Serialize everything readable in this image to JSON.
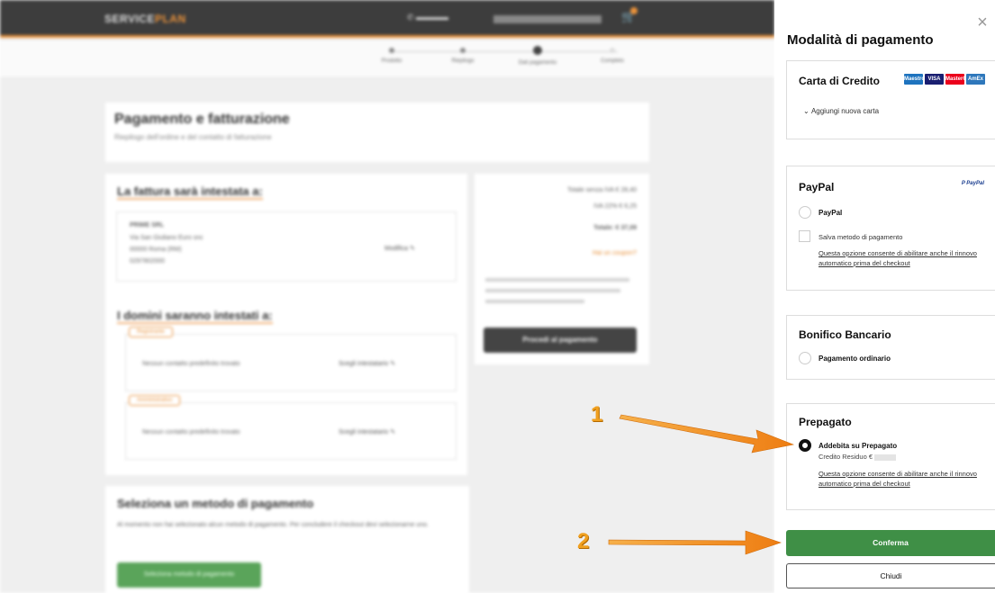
{
  "background": {
    "logo_prefix": "SERVICE",
    "logo_accent": "PLAN",
    "steps": [
      {
        "label": "Prodotto"
      },
      {
        "label": "Riepilogo"
      },
      {
        "label": "Dati pagamento"
      },
      {
        "label": "Completo"
      }
    ],
    "billing_title": "Pagamento e fatturazione",
    "billing_subtitle": "Riepilogo dell'ordine e del contatto di fatturazione",
    "invoice_heading": "La fattura sarà intestata a:",
    "invoice_company": "PRIME SRL",
    "invoice_lines": [
      "Via San Giuliano Euro snc",
      "00000 Roma (RM)",
      "0297802000"
    ],
    "edit_label": "Modifica",
    "domains_heading": "I domini saranno intestati a:",
    "tag_registrant": "Registrante",
    "tag_admin": "Amministrativo",
    "no_contact": "Nessun contatto predefinito trovato",
    "choose_contact": "Scegli intestatario",
    "summary_lines": [
      "Totale senza IVA € 28,40",
      "IVA 22% € 6,25",
      "Totale: € 37,09"
    ],
    "coupon_link": "Hai un coupon?",
    "proceed_button": "Procedi al pagamento",
    "select_method_title": "Seleziona un metodo di pagamento",
    "select_method_text": "Al momento non hai selezionato alcun metodo di pagamento. Per concludere il checkout devi selezionarne uno.",
    "select_method_button": "Seleziona metodo di pagamento"
  },
  "panel": {
    "title": "Modalità di pagamento",
    "close_icon": "×",
    "credit_card": {
      "title": "Carta di Credito",
      "add_card": "Aggiungi nuova carta",
      "card_icons": [
        "Maestro",
        "VISA",
        "MasterCard",
        "AmEx"
      ]
    },
    "paypal": {
      "title": "PayPal",
      "logo": "P PayPal",
      "option": "PayPal",
      "save_method": "Salva metodo di pagamento",
      "note": "Questa opzione consente di abilitare anche il rinnovo automatico prima del checkout"
    },
    "bank": {
      "title": "Bonifico Bancario",
      "option": "Pagamento ordinario"
    },
    "prepaid": {
      "title": "Prepagato",
      "option": "Addebita su Prepagato",
      "credit_label": "Credito Residuo €",
      "note": "Questa opzione consente di abilitare anche il rinnovo automatico prima del checkout"
    },
    "confirm_button": "Conferma",
    "close_button": "Chiudi"
  },
  "annotations": {
    "step1": "1",
    "step2": "2"
  },
  "colors": {
    "confirm_green": "#3f8f46",
    "arrow_orange": "#f08a1c",
    "brand_orange": "#e8913a"
  }
}
